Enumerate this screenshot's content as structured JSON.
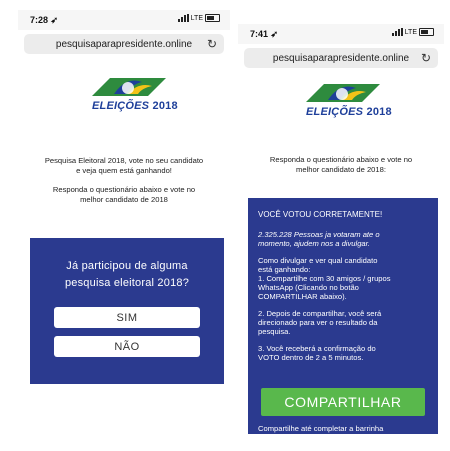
{
  "left_phone": {
    "status": {
      "time": "7:28 ➶",
      "network": "LTE"
    },
    "url": "pesquisaparapresidente.online",
    "logo": {
      "text": "ELEIÇÕES",
      "year": "2018"
    },
    "intro": {
      "line1": "Pesquisa Eleitoral 2018, vote no seu candidato",
      "line2": "e veja quem está ganhando!",
      "line3": "Responda o questionário abaixo e vote no",
      "line4": "melhor candidato de 2018"
    },
    "question": {
      "line1": "Já participou de alguma",
      "line2": "pesquisa eleitoral 2018?"
    },
    "answers": {
      "yes": "SIM",
      "no": "NÃO"
    }
  },
  "right_phone": {
    "status": {
      "time": "7:41 ➶",
      "network": "LTE"
    },
    "url": "pesquisaparapresidente.online",
    "logo": {
      "text": "ELEIÇÕES",
      "year": "2018"
    },
    "intro": {
      "line1": "Responda o questionário abaixo e vote no",
      "line2": "melhor candidato de 2018:"
    },
    "voted": "VOCÊ VOTOU CORRETAMENTE!",
    "count": {
      "line1": "2.325.228 Pessoas ja votaram ate o",
      "line2": "momento, ajudem nos a divulgar."
    },
    "instructions": [
      "Como divulgar e ver qual candidato",
      "está ganhando:",
      "1. Compartilhe com 30 amigos / grupos",
      "WhatsApp (Clicando no botão",
      "COMPARTILHAR abaixo).",
      "",
      "2. Depois de compartilhar, você será",
      "direcionado para ver o resultado da",
      "pesquisa.",
      "",
      "3. Você receberá a confirmação do",
      "VOTO dentro de 2 a 5 minutos."
    ],
    "share_button": "COMPARTILHAR",
    "footer": "Compartilhe até completar a barrinha"
  },
  "colors": {
    "panel_blue": "#2b3a8f",
    "share_green": "#59b84c",
    "logo_blue": "#1e3f9a",
    "flag_green": "#2e8b3e",
    "flag_yellow": "#f2c318"
  }
}
